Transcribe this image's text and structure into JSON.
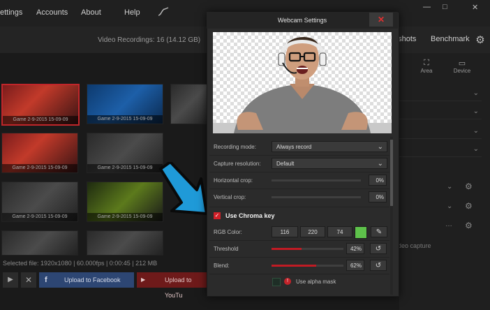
{
  "menu": {
    "items": [
      "ettings",
      "Accounts",
      "About",
      "Help"
    ],
    "window_controls": [
      "—",
      "□",
      "✕"
    ]
  },
  "toolbar": {
    "recordings_label": "Video Recordings: 16 (14.12 GB)",
    "screenshots_label": "nshots",
    "benchmark_label": "Benchmark"
  },
  "right_panel": {
    "area_label": "Area",
    "device_label": "Device",
    "video_capture_label": "ideo capture"
  },
  "library": {
    "thumb_caption_a": "Game 2-9-2015 15-09-09",
    "thumb_caption_b": "Game 2-9-2015 15-09-09",
    "status_text": "Selected file:  1920x1080 | 60.000fps | 0:00:45 | 212 MB",
    "upload_facebook": "Upload to Facebook",
    "upload_youtube": "Upload to YouTu"
  },
  "dialog": {
    "title": "Webcam Settings",
    "close_icon": "close-icon",
    "recording_mode": {
      "label": "Recording mode:",
      "value": "Always record"
    },
    "capture_resolution": {
      "label": "Capture resolution:",
      "value": "Default"
    },
    "horizontal_crop": {
      "label": "Horizontal crop:",
      "value": "0%",
      "level": 0
    },
    "vertical_crop": {
      "label": "Vertical crop:",
      "value": "0%",
      "level": 0
    },
    "chroma_key": {
      "label": "Use Chroma key",
      "checked": true
    },
    "rgb_color": {
      "label": "RGB Color:",
      "r": "116",
      "g": "220",
      "b": "74",
      "swatch": "#74dc4a"
    },
    "threshold": {
      "label": "Threshold",
      "value": "42%",
      "level": 0.42
    },
    "blend": {
      "label": "Blend:",
      "value": "62%",
      "level": 0.62
    },
    "alpha_mask": {
      "label": "Use alpha mask",
      "checked": false
    }
  },
  "colors": {
    "accent": "#c01b24",
    "dialog_bg": "#2b2b2b",
    "facebook": "#2d4673"
  }
}
